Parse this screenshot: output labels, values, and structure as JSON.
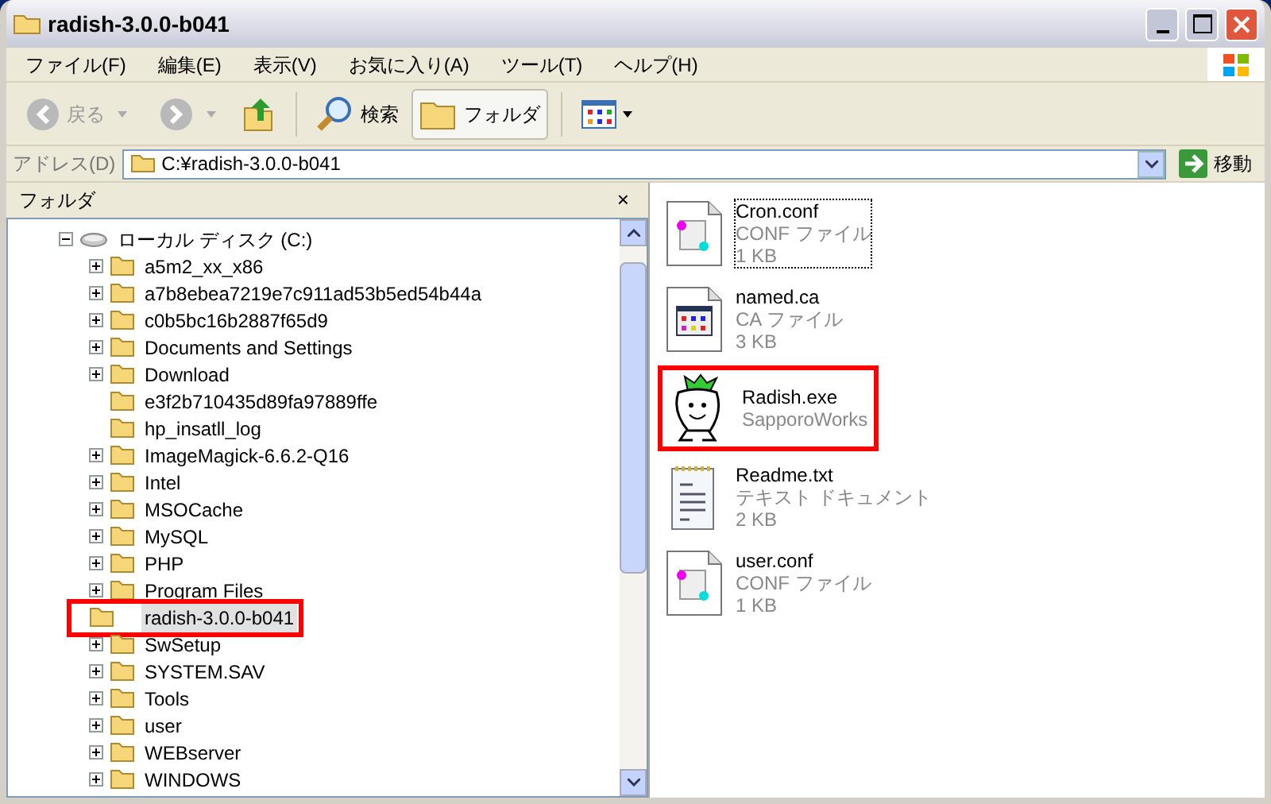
{
  "window": {
    "title": "radish-3.0.0-b041"
  },
  "menu": [
    "ファイル(F)",
    "編集(E)",
    "表示(V)",
    "お気に入り(A)",
    "ツール(T)",
    "ヘルプ(H)"
  ],
  "toolbar": {
    "back": {
      "label": "戻る",
      "disabled": true
    },
    "search": {
      "label": "検索"
    },
    "folders": {
      "label": "フォルダ",
      "selected": true
    }
  },
  "address": {
    "label": "アドレス(D)",
    "value": "C:¥radish-3.0.0-b041",
    "go": "移動"
  },
  "folder_pane": {
    "title": "フォルダ",
    "close": "×",
    "tree": [
      {
        "label": "ローカル ディスク (C:)",
        "kind": "drive",
        "expanded": true,
        "children": [
          {
            "label": "a5m2_xx_x86",
            "expandable": true,
            "selected": false
          },
          {
            "label": "a7b8ebea7219e7c911ad53b5ed54b44a",
            "expandable": true,
            "selected": false
          },
          {
            "label": "c0b5bc16b2887f65d9",
            "expandable": true,
            "selected": false
          },
          {
            "label": "Documents and Settings",
            "expandable": true,
            "selected": false
          },
          {
            "label": "Download",
            "expandable": true,
            "selected": false
          },
          {
            "label": "e3f2b710435d89fa97889ffe",
            "expandable": false,
            "selected": false
          },
          {
            "label": "hp_insatll_log",
            "expandable": false,
            "selected": false
          },
          {
            "label": "ImageMagick-6.6.2-Q16",
            "expandable": true,
            "selected": false
          },
          {
            "label": "Intel",
            "expandable": true,
            "selected": false
          },
          {
            "label": "MSOCache",
            "expandable": true,
            "selected": false
          },
          {
            "label": "MySQL",
            "expandable": true,
            "selected": false
          },
          {
            "label": "PHP",
            "expandable": true,
            "selected": false
          },
          {
            "label": "Program Files",
            "expandable": true,
            "selected": false
          },
          {
            "label": "radish-3.0.0-b041",
            "expandable": false,
            "selected": true,
            "annotated": true
          },
          {
            "label": "SwSetup",
            "expandable": true,
            "selected": false
          },
          {
            "label": "SYSTEM.SAV",
            "expandable": true,
            "selected": false
          },
          {
            "label": "Tools",
            "expandable": true,
            "selected": false
          },
          {
            "label": "user",
            "expandable": true,
            "selected": false
          },
          {
            "label": "WEBserver",
            "expandable": true,
            "selected": false
          },
          {
            "label": "WINDOWS",
            "expandable": true,
            "selected": false
          }
        ]
      }
    ]
  },
  "files": [
    {
      "kind": "conf",
      "name": "Cron.conf",
      "type": "CONF ファイル",
      "size": "1 KB",
      "focused": true,
      "annotated": false
    },
    {
      "kind": "ca",
      "name": "named.ca",
      "type": "CA ファイル",
      "size": "3 KB",
      "focused": false,
      "annotated": false
    },
    {
      "kind": "exe",
      "name": "Radish.exe",
      "type": "SapporoWorks",
      "focused": false,
      "annotated": true
    },
    {
      "kind": "txt",
      "name": "Readme.txt",
      "type": "テキスト ドキュメント",
      "size": "2 KB",
      "focused": false,
      "annotated": false
    },
    {
      "kind": "conf",
      "name": "user.conf",
      "type": "CONF ファイル",
      "size": "1 KB",
      "focused": false,
      "annotated": false
    }
  ]
}
